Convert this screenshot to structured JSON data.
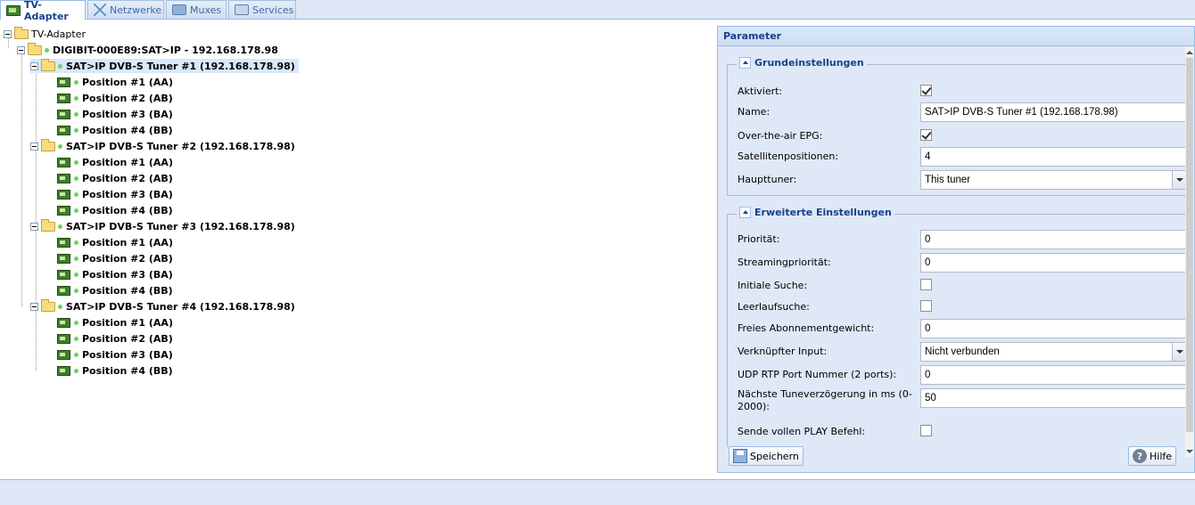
{
  "tabs": [
    {
      "label": "TV-Adapter",
      "icon": "tv-adapter-icon",
      "active": true
    },
    {
      "label": "Netzwerke",
      "icon": "network-icon",
      "active": false
    },
    {
      "label": "Muxes",
      "icon": "mux-icon",
      "active": false
    },
    {
      "label": "Services",
      "icon": "services-icon",
      "active": false
    }
  ],
  "tree": {
    "root": "TV-Adapter",
    "device": "DIGIBIT-000E89:SAT>IP - 192.168.178.98",
    "tuners": [
      {
        "label": "SAT>IP DVB-S Tuner #1 (192.168.178.98)",
        "selected": true,
        "positions": [
          "Position #1 (AA)",
          "Position #2 (AB)",
          "Position #3 (BA)",
          "Position #4 (BB)"
        ]
      },
      {
        "label": "SAT>IP DVB-S Tuner #2 (192.168.178.98)",
        "selected": false,
        "positions": [
          "Position #1 (AA)",
          "Position #2 (AB)",
          "Position #3 (BA)",
          "Position #4 (BB)"
        ]
      },
      {
        "label": "SAT>IP DVB-S Tuner #3 (192.168.178.98)",
        "selected": false,
        "positions": [
          "Position #1 (AA)",
          "Position #2 (AB)",
          "Position #3 (BA)",
          "Position #4 (BB)"
        ]
      },
      {
        "label": "SAT>IP DVB-S Tuner #4 (192.168.178.98)",
        "selected": false,
        "positions": [
          "Position #1 (AA)",
          "Position #2 (AB)",
          "Position #3 (BA)",
          "Position #4 (BB)"
        ]
      }
    ]
  },
  "panel": {
    "title": "Parameter",
    "basic": {
      "legend": "Grundeinstellungen",
      "enabled_label": "Aktiviert:",
      "enabled": true,
      "name_label": "Name:",
      "name_value": "SAT>IP DVB-S Tuner #1 (192.168.178.98)",
      "epg_label": "Over-the-air EPG:",
      "epg": true,
      "satpos_label": "Satellitenpositionen:",
      "satpos_value": "4",
      "master_label": "Haupttuner:",
      "master_value": "This tuner"
    },
    "advanced": {
      "legend": "Erweiterte Einstellungen",
      "priority_label": "Priorität:",
      "priority_value": "0",
      "streampriority_label": "Streamingpriorität:",
      "streampriority_value": "0",
      "initscan_label": "Initiale Suche:",
      "initscan": false,
      "idlescan_label": "Leerlaufsuche:",
      "idlescan": false,
      "freeweight_label": "Freies Abonnementgewicht:",
      "freeweight_value": "0",
      "linked_label": "Verknüpfter Input:",
      "linked_value": "Nicht verbunden",
      "udp_label": "UDP RTP Port Nummer (2 ports):",
      "udp_value": "0",
      "tunedelay_label": "Nächste Tuneverzögerung in ms (0-2000):",
      "tunedelay_value": "50",
      "fullplay_label": "Sende vollen PLAY Befehl:",
      "fullplay": false
    },
    "save_label": "Speichern",
    "help_label": "Hilfe"
  }
}
